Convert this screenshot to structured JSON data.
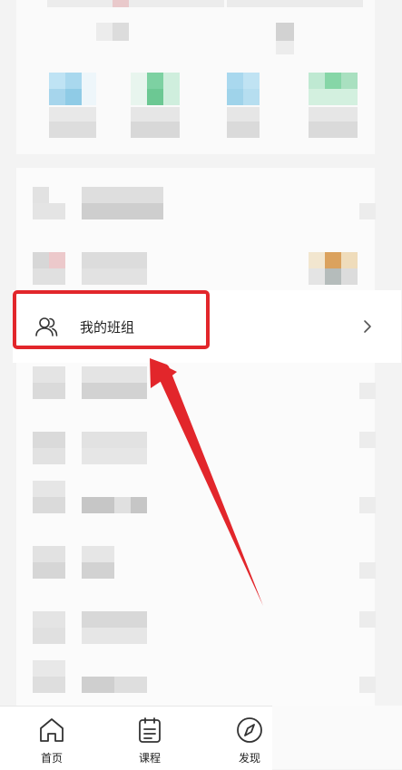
{
  "menu": {
    "my_class_label": "我的班组"
  },
  "tabbar": {
    "home_label": "首页",
    "course_label": "课程",
    "discover_label": "发现"
  },
  "colors": {
    "highlight": "#e2262b",
    "text": "#222222"
  },
  "icons": {
    "class_icon": "group-icon",
    "chevron": "chevron-right-icon",
    "home": "home-icon",
    "course": "clipboard-icon",
    "discover": "compass-icon"
  }
}
